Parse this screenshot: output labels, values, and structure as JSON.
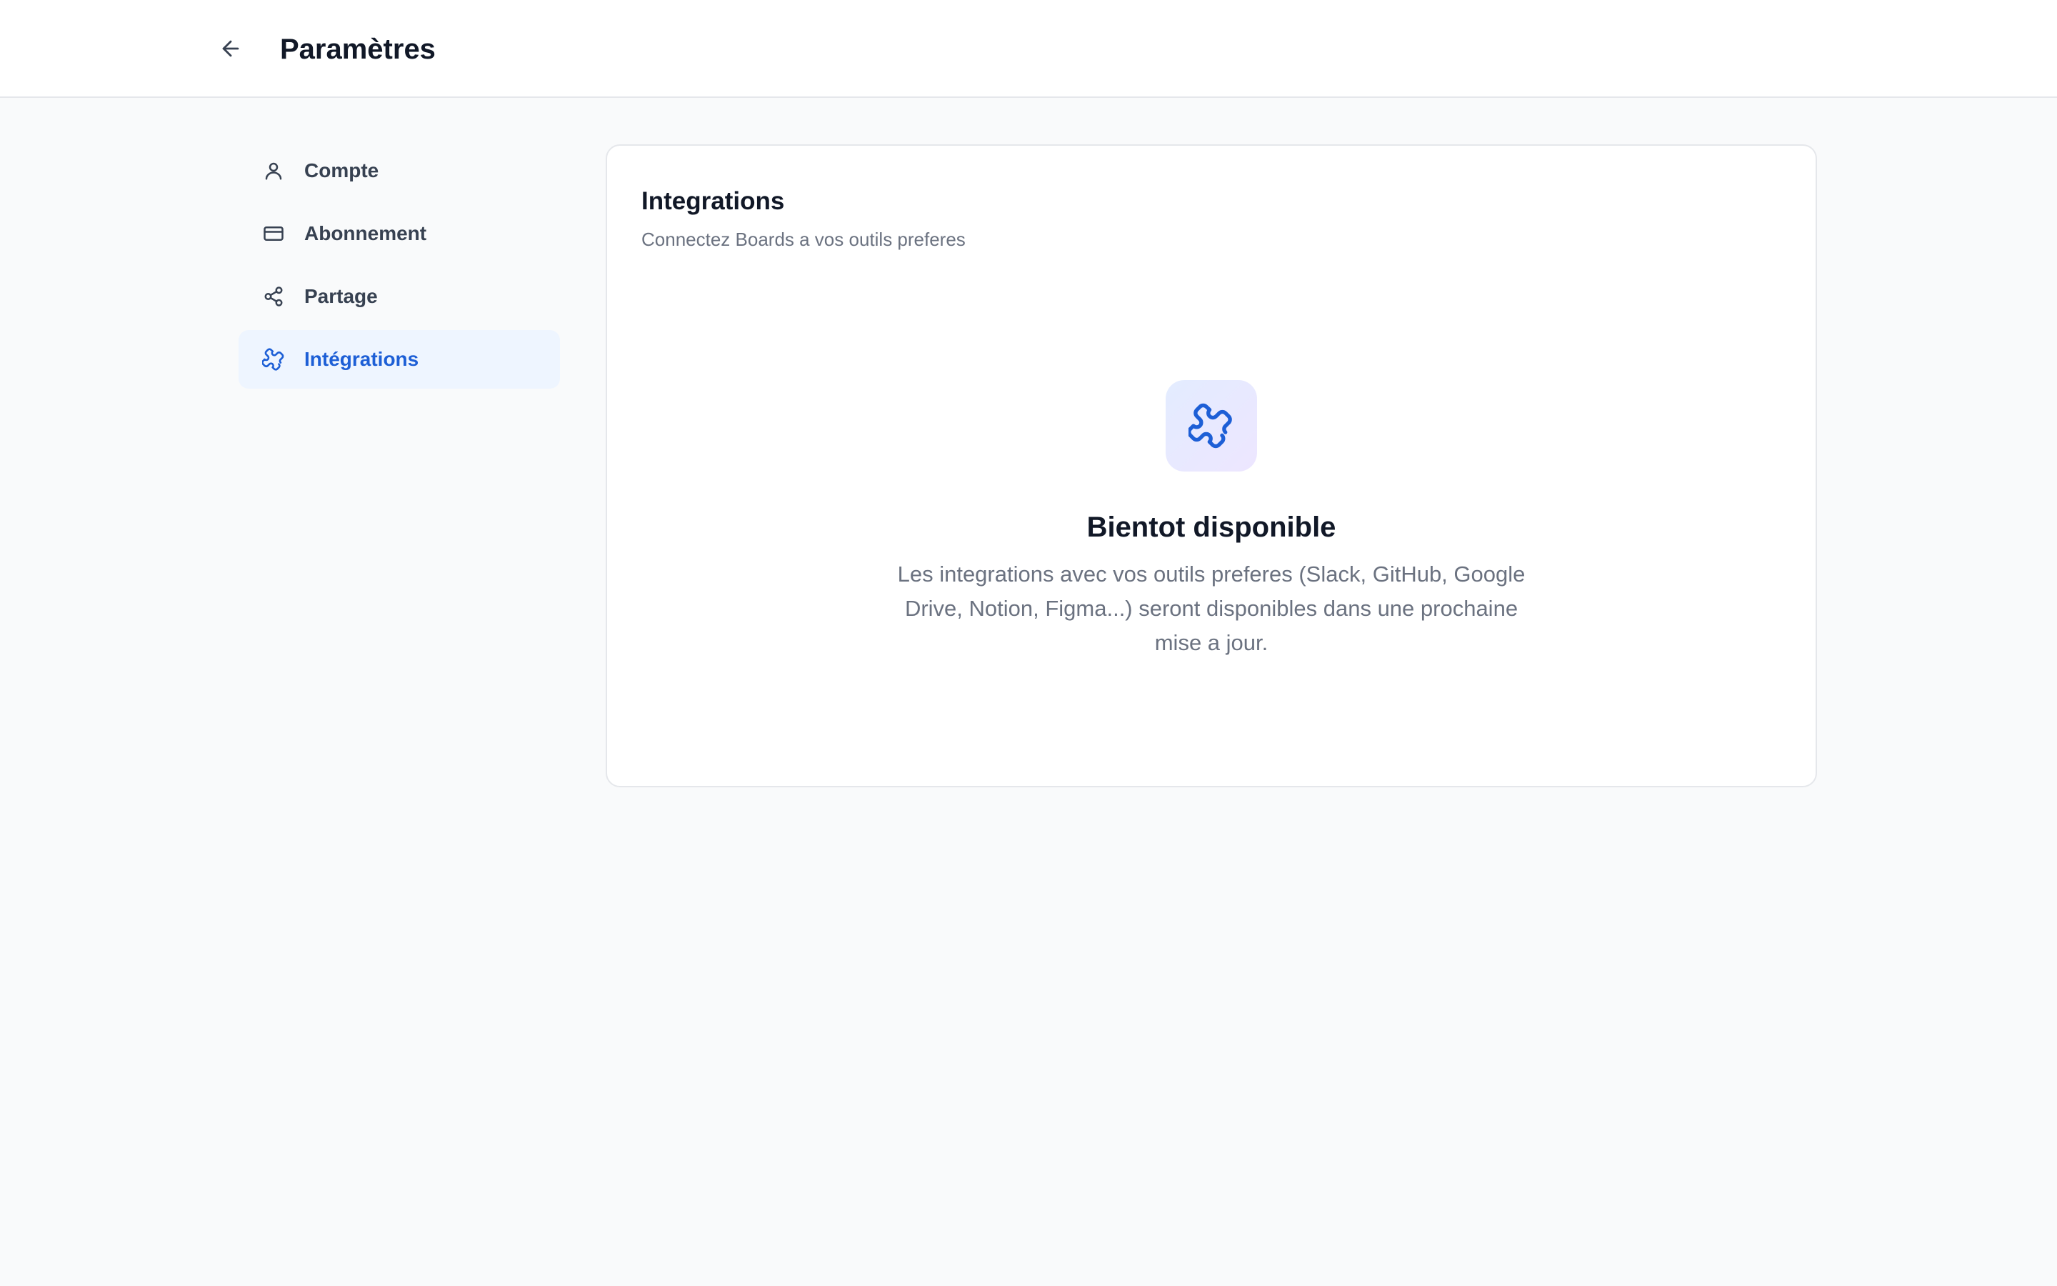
{
  "header": {
    "back_icon": "arrow-left-icon",
    "title": "Paramètres"
  },
  "sidebar": {
    "items": [
      {
        "label": "Compte",
        "icon": "user-icon",
        "active": false
      },
      {
        "label": "Abonnement",
        "icon": "credit-card-icon",
        "active": false
      },
      {
        "label": "Partage",
        "icon": "share-icon",
        "active": false
      },
      {
        "label": "Intégrations",
        "icon": "puzzle-icon",
        "active": true
      }
    ]
  },
  "main": {
    "title": "Integrations",
    "subtitle": "Connectez Boards a vos outils preferes",
    "empty_state": {
      "icon": "puzzle-icon",
      "title": "Bientot disponible",
      "description": "Les integrations avec vos outils preferes (Slack, GitHub, Google Drive, Notion, Figma...) seront disponibles dans une prochaine mise a jour."
    }
  },
  "colors": {
    "accent": "#1d5fd6",
    "active_bg": "#eef5ff",
    "page_bg": "#f9fafb",
    "muted_text": "#6b7280"
  }
}
